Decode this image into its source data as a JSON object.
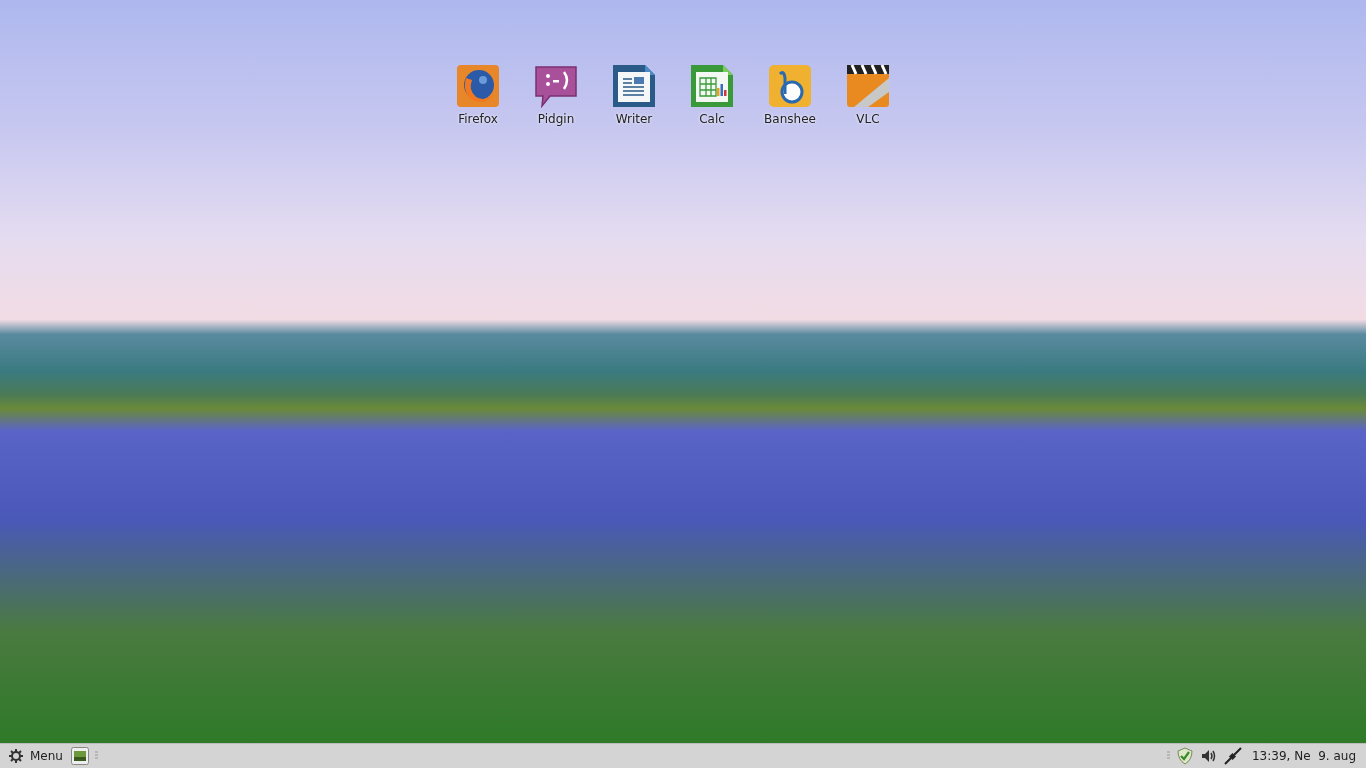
{
  "desktop_icons": [
    {
      "label": "Firefox",
      "kind": "firefox"
    },
    {
      "label": "Pidgin",
      "kind": "pidgin"
    },
    {
      "label": "Writer",
      "kind": "writer"
    },
    {
      "label": "Calc",
      "kind": "calc"
    },
    {
      "label": "Banshee",
      "kind": "banshee"
    },
    {
      "label": "VLC",
      "kind": "vlc"
    }
  ],
  "panel": {
    "menu_button": {
      "label": "Menu"
    },
    "clock": "13:39, Ne  9. aug"
  }
}
